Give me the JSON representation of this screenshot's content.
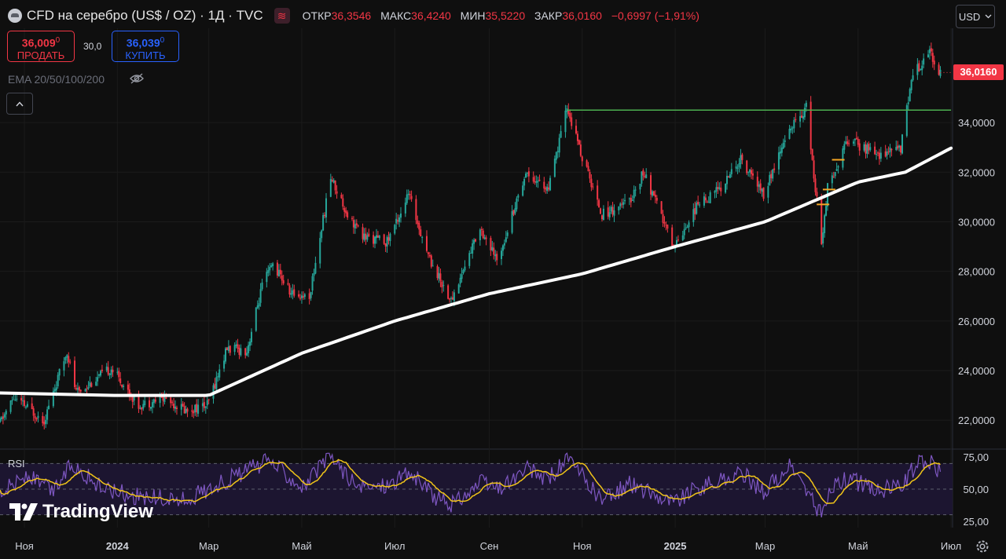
{
  "header": {
    "title": "CFD на серебро (US$ / OZ) · 1Д · TVC",
    "indicator_badge": "≋",
    "ohlc": [
      {
        "key": "ОТКР",
        "value": "36,3546"
      },
      {
        "key": "МАКС",
        "value": "36,4240"
      },
      {
        "key": "МИН",
        "value": "35,5220"
      },
      {
        "key": "ЗАКР",
        "value": "36,0160"
      }
    ],
    "change": "−0,6997 (−1,91%)"
  },
  "currency": {
    "label": "USD",
    "icon": "chevron-down-icon"
  },
  "trade": {
    "sell_price": "36,009",
    "sell_price_sup": "0",
    "sell_label": "ПРОДАТЬ",
    "spread": "30,0",
    "buy_price": "36,039",
    "buy_price_sup": "0",
    "buy_label": "КУПИТЬ"
  },
  "ema_label": "EMA 20/50/100/200",
  "last_price_tag": "36,0160",
  "rsi_label": "RSI",
  "logo_text": "TradingView",
  "colors": {
    "up": "#26a69a",
    "down": "#f23645",
    "ema": "#ffffff",
    "resistance": "#4caf50",
    "rsi": "#7e57c2",
    "rsi_ma": "#f0c419",
    "background": "#0f0f0f",
    "grid": "#1b1b1b"
  },
  "chart_data": {
    "type": "candlestick",
    "timeframe": "1D",
    "ylim": [
      20900,
      37800
    ],
    "yticks": [
      "22,0000",
      "24,0000",
      "26,0000",
      "28,0000",
      "30,0000",
      "32,0000",
      "34,0000"
    ],
    "xticks": [
      "Ноя",
      "2024",
      "Мар",
      "Май",
      "Июл",
      "Сен",
      "Ноя",
      "2025",
      "Мар",
      "Май",
      "Июл"
    ],
    "x_range": [
      "2023-10-16",
      "2025-07-02"
    ],
    "price_path": [
      [
        "2023-10-16",
        21900
      ],
      [
        "2023-10-25",
        22900
      ],
      [
        "2023-11-14",
        22000
      ],
      [
        "2023-11-29",
        24800
      ],
      [
        "2023-12-05",
        23100
      ],
      [
        "2023-12-28",
        24100
      ],
      [
        "2024-01-15",
        22600
      ],
      [
        "2024-02-01",
        22900
      ],
      [
        "2024-02-15",
        22400
      ],
      [
        "2024-02-29",
        22600
      ],
      [
        "2024-03-13",
        24900
      ],
      [
        "2024-03-26",
        24800
      ],
      [
        "2024-04-05",
        27400
      ],
      [
        "2024-04-12",
        28300
      ],
      [
        "2024-04-24",
        27100
      ],
      [
        "2024-05-06",
        27000
      ],
      [
        "2024-05-20",
        31800
      ],
      [
        "2024-05-31",
        30300
      ],
      [
        "2024-06-10",
        29400
      ],
      [
        "2024-06-26",
        29200
      ],
      [
        "2024-07-10",
        31100
      ],
      [
        "2024-07-24",
        28500
      ],
      [
        "2024-08-07",
        26800
      ],
      [
        "2024-08-26",
        29800
      ],
      [
        "2024-09-06",
        28400
      ],
      [
        "2024-09-25",
        32000
      ],
      [
        "2024-10-10",
        31300
      ],
      [
        "2024-10-22",
        34600
      ],
      [
        "2024-11-01",
        32600
      ],
      [
        "2024-11-14",
        30300
      ],
      [
        "2024-12-02",
        30800
      ],
      [
        "2024-12-11",
        32000
      ],
      [
        "2024-12-31",
        29000
      ],
      [
        "2025-01-15",
        30600
      ],
      [
        "2025-01-31",
        31400
      ],
      [
        "2025-02-13",
        32500
      ],
      [
        "2025-02-28",
        31100
      ],
      [
        "2025-03-17",
        33700
      ],
      [
        "2025-03-28",
        34600
      ],
      [
        "2025-04-07",
        29200
      ],
      [
        "2025-04-11",
        31400
      ],
      [
        "2025-04-24",
        33300
      ],
      [
        "2025-05-14",
        32700
      ],
      [
        "2025-05-29",
        33000
      ],
      [
        "2025-06-05",
        35800
      ],
      [
        "2025-06-17",
        36900
      ],
      [
        "2025-06-24",
        36000
      ]
    ],
    "ema200": [
      [
        "2023-10-16",
        23100
      ],
      [
        "2023-12-31",
        23000
      ],
      [
        "2024-03-01",
        23000
      ],
      [
        "2024-05-01",
        24700
      ],
      [
        "2024-07-01",
        26000
      ],
      [
        "2024-09-01",
        27100
      ],
      [
        "2024-11-01",
        27900
      ],
      [
        "2025-01-01",
        29000
      ],
      [
        "2025-03-01",
        30000
      ],
      [
        "2025-05-01",
        31600
      ],
      [
        "2025-06-01",
        32000
      ],
      [
        "2025-07-02",
        33000
      ]
    ],
    "resistance": {
      "from": "2024-10-22",
      "to": "2025-07-01",
      "price": 34500
    },
    "markers": [
      {
        "date": "2025-04-12",
        "price": 31300
      },
      {
        "date": "2025-04-18",
        "price": 32500
      },
      {
        "date": "2025-04-08",
        "price": 30700
      }
    ],
    "last_price": 36016,
    "rsi": {
      "ylim": [
        20,
        80
      ],
      "yticks": [
        "75,00",
        "50,00",
        "25,00"
      ],
      "band": [
        30,
        70
      ],
      "path": [
        [
          "2023-10-16",
          48
        ],
        [
          "2023-11-03",
          60
        ],
        [
          "2023-11-20",
          48
        ],
        [
          "2023-12-02",
          70
        ],
        [
          "2023-12-20",
          52
        ],
        [
          "2024-01-15",
          44
        ],
        [
          "2024-02-14",
          41
        ],
        [
          "2024-03-04",
          52
        ],
        [
          "2024-03-27",
          65
        ],
        [
          "2024-04-10",
          72
        ],
        [
          "2024-05-02",
          52
        ],
        [
          "2024-05-20",
          76
        ],
        [
          "2024-06-07",
          50
        ],
        [
          "2024-06-27",
          54
        ],
        [
          "2024-07-11",
          63
        ],
        [
          "2024-07-26",
          45
        ],
        [
          "2024-08-07",
          38
        ],
        [
          "2024-08-27",
          55
        ],
        [
          "2024-09-07",
          50
        ],
        [
          "2024-09-26",
          65
        ],
        [
          "2024-10-10",
          58
        ],
        [
          "2024-10-22",
          74
        ],
        [
          "2024-11-14",
          41
        ],
        [
          "2024-12-02",
          54
        ],
        [
          "2024-12-31",
          40
        ],
        [
          "2025-01-15",
          50
        ],
        [
          "2025-02-14",
          62
        ],
        [
          "2025-02-28",
          48
        ],
        [
          "2025-03-18",
          68
        ],
        [
          "2025-04-07",
          30
        ],
        [
          "2025-04-14",
          52
        ],
        [
          "2025-04-24",
          58
        ],
        [
          "2025-05-14",
          49
        ],
        [
          "2025-05-29",
          52
        ],
        [
          "2025-06-09",
          70
        ],
        [
          "2025-06-17",
          72
        ],
        [
          "2025-06-24",
          64
        ]
      ]
    }
  }
}
